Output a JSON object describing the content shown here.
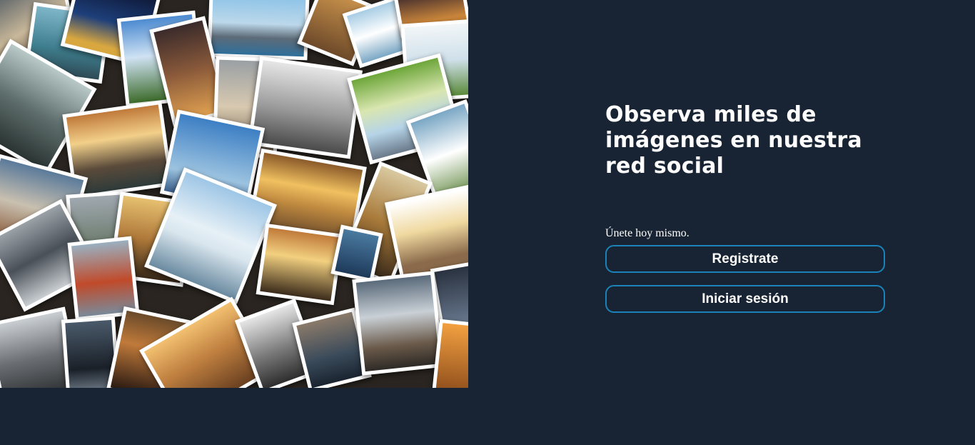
{
  "hero": {
    "headline": "Observa miles de imágenes en nuestra red social"
  },
  "cta": {
    "join_text": "Únete hoy mismo.",
    "register_label": "Registrate",
    "login_label": "Iniciar sesión"
  },
  "colors": {
    "background": "#182433",
    "button_border": "#1b83b9",
    "text": "#ffffff"
  }
}
